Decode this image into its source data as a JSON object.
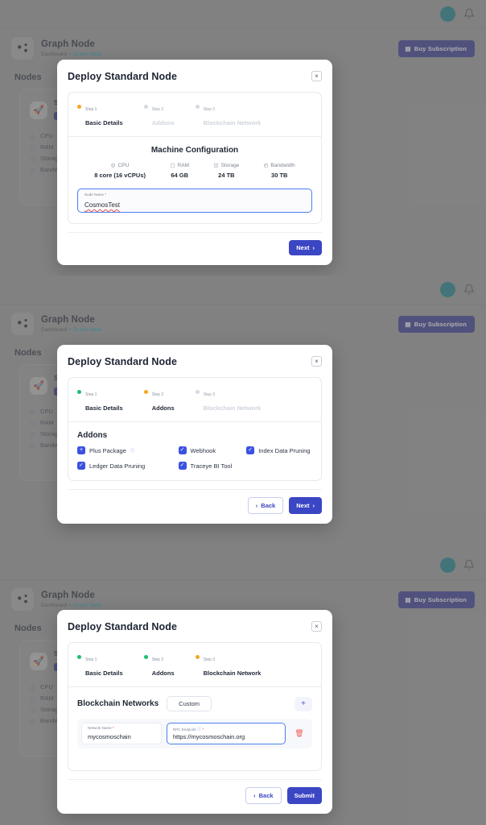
{
  "app": {
    "page_title": "Graph Node",
    "breadcrumb": {
      "root": "Dashboard",
      "separator": "•",
      "current": "Graph Node"
    },
    "buy_button": "Buy Subscription",
    "section_heading": "Nodes",
    "avatar_color": "#0e7c8a",
    "accent_color": "#2e3191"
  },
  "node_card": {
    "name": "Standard",
    "badge": "Deploy",
    "specs": [
      {
        "label": "CPU"
      },
      {
        "label": "RAM"
      },
      {
        "label": "Storage"
      },
      {
        "label": "Bandwidth"
      }
    ]
  },
  "modal": {
    "title": "Deploy Standard Node",
    "close_label": "×",
    "steps": [
      {
        "num": "Step 1",
        "label": "Basic Details"
      },
      {
        "num": "Step 2",
        "label": "Addons"
      },
      {
        "num": "Step 3",
        "label": "Blockchain Network"
      }
    ]
  },
  "step1": {
    "machine_config_title": "Machine Configuration",
    "specs": [
      {
        "label": "CPU",
        "value": "8 core (16 vCPUs)"
      },
      {
        "label": "RAM",
        "value": "64 GB"
      },
      {
        "label": "Storage",
        "value": "24 TB"
      },
      {
        "label": "Bandwidth",
        "value": "30 TB"
      }
    ],
    "node_name_label": "Node Name",
    "node_name_required": "*",
    "node_name_value": "CosmosTest",
    "next_button": "Next"
  },
  "step2": {
    "heading": "Addons",
    "items": [
      {
        "label": "Plus Package",
        "mark": "+",
        "has_info": true
      },
      {
        "label": "Webhook",
        "mark": "✓",
        "has_info": false
      },
      {
        "label": "Index Data Pruning",
        "mark": "✓",
        "has_info": false
      },
      {
        "label": "Ledger Data Pruning",
        "mark": "✓",
        "has_info": false
      },
      {
        "label": "Traceye BI Tool",
        "mark": "✓",
        "has_info": false
      }
    ],
    "back_button": "Back",
    "next_button": "Next"
  },
  "step3": {
    "heading": "Blockchain Networks",
    "chip": "Custom",
    "add_label": "+",
    "network_name_label": "Network Name",
    "network_name_required": "*",
    "network_name_value": "mycosmoschain",
    "rpc_label": "RPC Endpoint",
    "rpc_required": "*",
    "rpc_value": "https://mycosmoschain.org",
    "back_button": "Back",
    "submit_button": "Submit"
  }
}
